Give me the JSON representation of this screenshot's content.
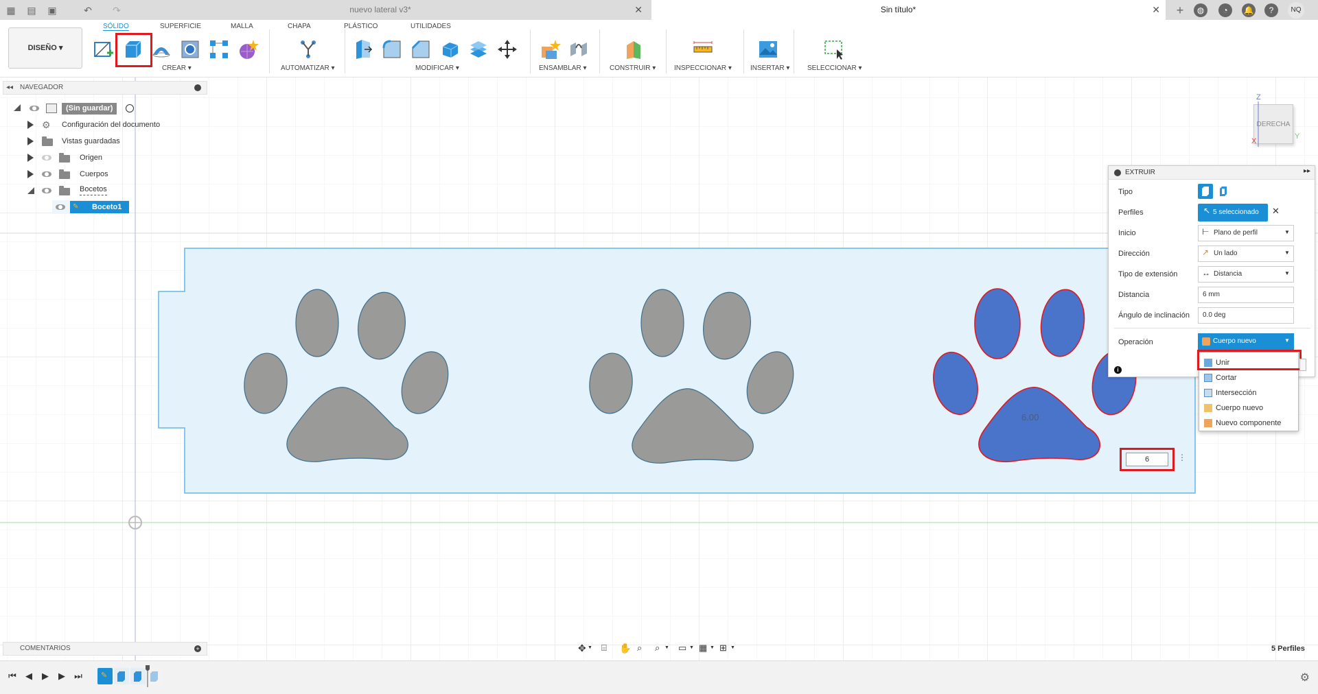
{
  "tabs": {
    "doc1": "nuevo lateral v3*",
    "doc2": "Sin título*",
    "user": "NQ"
  },
  "ribbon": {
    "design": "DISEÑO ▾",
    "tabs": [
      "SÓLIDO",
      "SUPERFICIE",
      "MALLA",
      "CHAPA",
      "PLÁSTICO",
      "UTILIDADES"
    ],
    "groups": [
      "CREAR ▾",
      "AUTOMATIZAR ▾",
      "MODIFICAR ▾",
      "ENSAMBLAR ▾",
      "CONSTRUIR ▾",
      "INSPECCIONAR ▾",
      "INSERTAR ▾",
      "SELECCIONAR ▾"
    ]
  },
  "nav": {
    "title": "NAVEGADOR",
    "root": "(Sin guardar)",
    "items": [
      "Configuración del documento",
      "Vistas guardadas",
      "Origen",
      "Cuerpos",
      "Bocetos"
    ],
    "sketch": "Boceto1"
  },
  "viewcube": {
    "face": "DERECHA",
    "z": "Z",
    "y": "Y",
    "x": "X"
  },
  "extrude": {
    "title": "EXTRUIR",
    "labels": [
      "Tipo",
      "Perfiles",
      "Inicio",
      "Dirección",
      "Tipo de extensión",
      "Distancia",
      "Ángulo de inclinación",
      "Operación"
    ],
    "profiles": "5 seleccionado",
    "start": "Plano de perfil",
    "direction": "Un lado",
    "extent": "Distancia",
    "distance": "6 mm",
    "angle": "0.0 deg",
    "operation": "Cuerpo nuevo",
    "options": [
      "Unir",
      "Cortar",
      "Intersección",
      "Cuerpo nuevo",
      "Nuevo componente"
    ]
  },
  "canvas": {
    "dim_label": "6.00",
    "dim_input": "6"
  },
  "footer": {
    "comments": "COMENTARIOS",
    "profiles_count": "5 Perfiles"
  },
  "colors": {
    "accent": "#0696d7",
    "selected_fill": "#4a74c9",
    "sketch_fill": "#e4f2fb",
    "paw_gray": "#9a9a98",
    "highlight": "#e0191e"
  }
}
